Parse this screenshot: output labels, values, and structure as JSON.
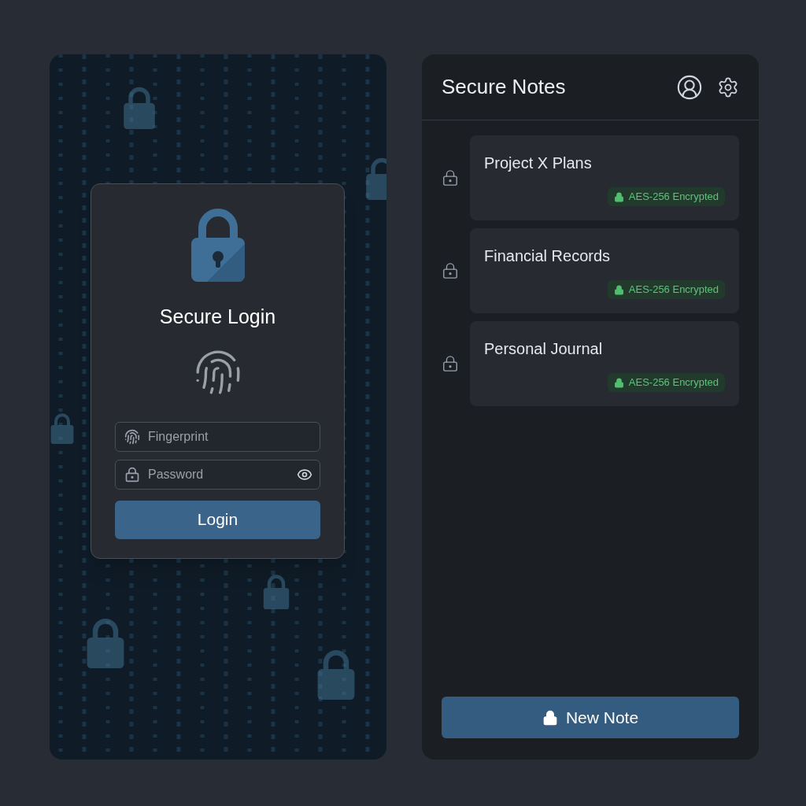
{
  "login": {
    "title": "Secure Login",
    "fields": [
      {
        "kind": "fingerprint",
        "placeholder": "Fingerprint"
      },
      {
        "kind": "password",
        "placeholder": "Password"
      }
    ],
    "button": "Login"
  },
  "notes": {
    "title": "Secure Notes",
    "items": [
      {
        "title": "Project X Plans",
        "badge": "AES-256 Encrypted"
      },
      {
        "title": "Financial Records",
        "badge": "AES-256 Encrypted"
      },
      {
        "title": "Personal Journal",
        "badge": "AES-256 Encrypted"
      }
    ],
    "button": "New Note"
  }
}
